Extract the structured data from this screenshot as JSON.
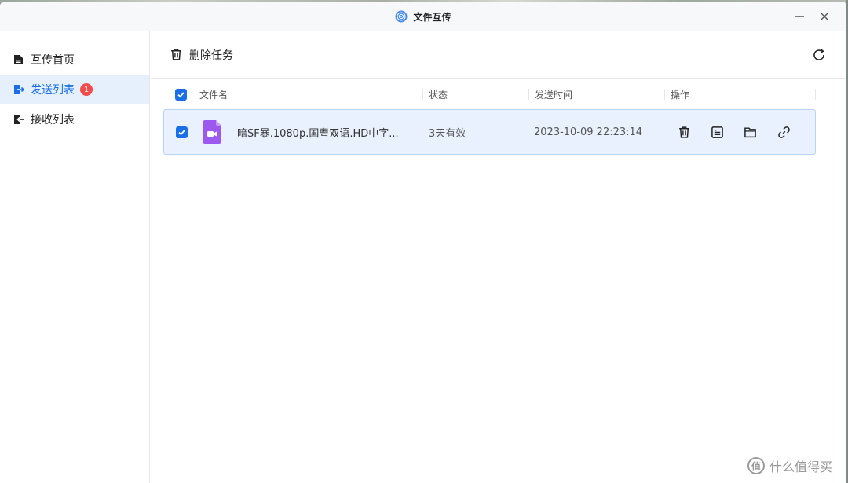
{
  "window": {
    "title": "文件互传",
    "app_icon": "wifi-transfer-icon",
    "controls": {
      "minimize": "minimize-icon",
      "close": "close-icon"
    }
  },
  "sidebar": {
    "items": [
      {
        "label": "互传首页",
        "icon": "home-doc-icon",
        "active": false
      },
      {
        "label": "发送列表",
        "icon": "send-list-icon",
        "active": true,
        "badge": "1"
      },
      {
        "label": "接收列表",
        "icon": "receive-list-icon",
        "active": false
      }
    ]
  },
  "toolbar": {
    "delete_label": "删除任务",
    "delete_icon": "trash-icon",
    "refresh_icon": "refresh-icon"
  },
  "table": {
    "columns": [
      "文件名",
      "状态",
      "发送时间",
      "操作"
    ],
    "rows": [
      {
        "checked": true,
        "file_icon": "video-file-icon",
        "file_name": "暗SF暴.1080p.国粤双语.HD中字...",
        "status": "3天有效",
        "time": "2023-10-09 22:23:14",
        "actions": [
          "trash-icon",
          "details-icon",
          "folder-icon",
          "link-icon"
        ]
      }
    ]
  },
  "watermark": {
    "logo_text": "值",
    "text": "什么值得买"
  },
  "colors": {
    "accent": "#1a6fe8",
    "badge": "#f24b4b",
    "selected_row": "#e8f1fd",
    "file_icon": "#9b59f0"
  }
}
